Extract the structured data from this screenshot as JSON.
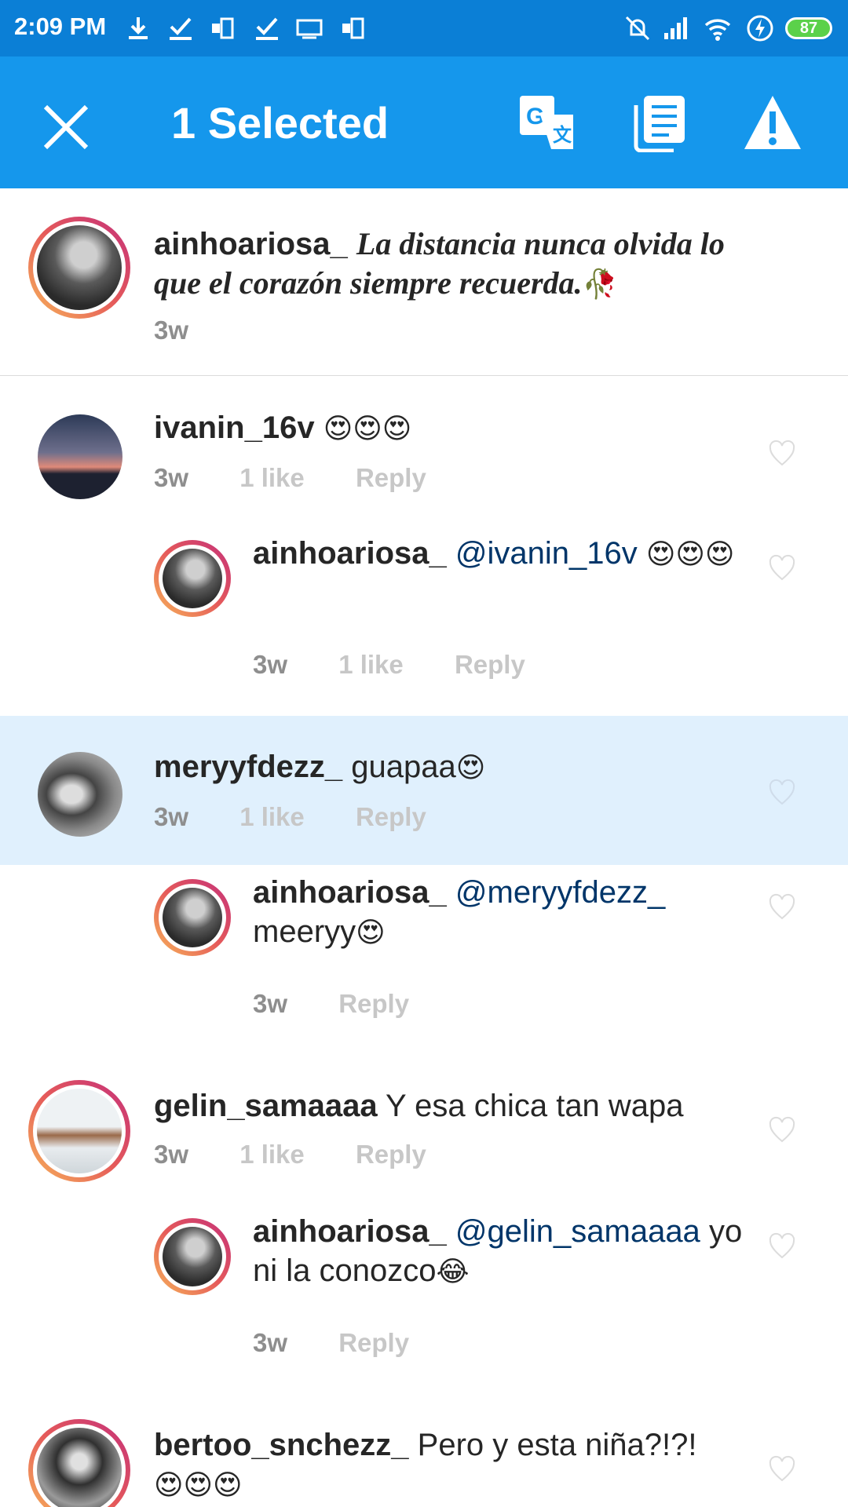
{
  "status_bar": {
    "time": "2:09 PM",
    "left_icons": [
      "download-icon",
      "check-icon",
      "remote-icon",
      "check-icon",
      "ftp-icon",
      "remote-icon"
    ],
    "right_icons": [
      "mute-icon",
      "signal-icon",
      "wifi-icon",
      "charging-icon"
    ],
    "battery": "87"
  },
  "action_bar": {
    "title": "1 Selected",
    "close_icon": "close-icon",
    "buttons": [
      "translate-icon",
      "copy-icon",
      "report-icon"
    ]
  },
  "caption": {
    "username": "ainhoariosa_",
    "text": "La distancia nunca olvida lo que el corazón siempre recuerda.",
    "emoji": "🥀",
    "time": "3w"
  },
  "comments": [
    {
      "username": "ivanin_16v",
      "text": "",
      "emoji": "😍😍😍",
      "time": "3w",
      "likes": "1 like",
      "reply": "Reply"
    },
    {
      "username": "ainhoariosa_",
      "mention": "@ivanin_16v",
      "text": "",
      "emoji": "😍😍😍",
      "time": "3w",
      "likes": "1 like",
      "reply": "Reply"
    },
    {
      "username": "meryyfdezz_",
      "text": "guapaa",
      "emoji": "😍",
      "time": "3w",
      "likes": "1 like",
      "reply": "Reply"
    },
    {
      "username": "ainhoariosa_",
      "mention": "@meryyfdezz_",
      "text": "meeryy",
      "emoji": "😍",
      "time": "3w",
      "reply": "Reply"
    },
    {
      "username": "gelin_samaaaa",
      "text": "Y esa chica tan wapa",
      "time": "3w",
      "likes": "1 like",
      "reply": "Reply"
    },
    {
      "username": "ainhoariosa_",
      "mention": "@gelin_samaaaa",
      "text": "yo ni la conozco",
      "emoji": "😂",
      "time": "3w",
      "reply": "Reply"
    },
    {
      "username": "bertoo_snchezz_",
      "text": "Pero y esta niña?!?!",
      "emoji": "😍😍😍"
    }
  ],
  "colors": {
    "status_bar": "#0b7fd6",
    "action_bar": "#1597ec",
    "selected_row": "#e0f0fd",
    "mention": "#003569"
  }
}
